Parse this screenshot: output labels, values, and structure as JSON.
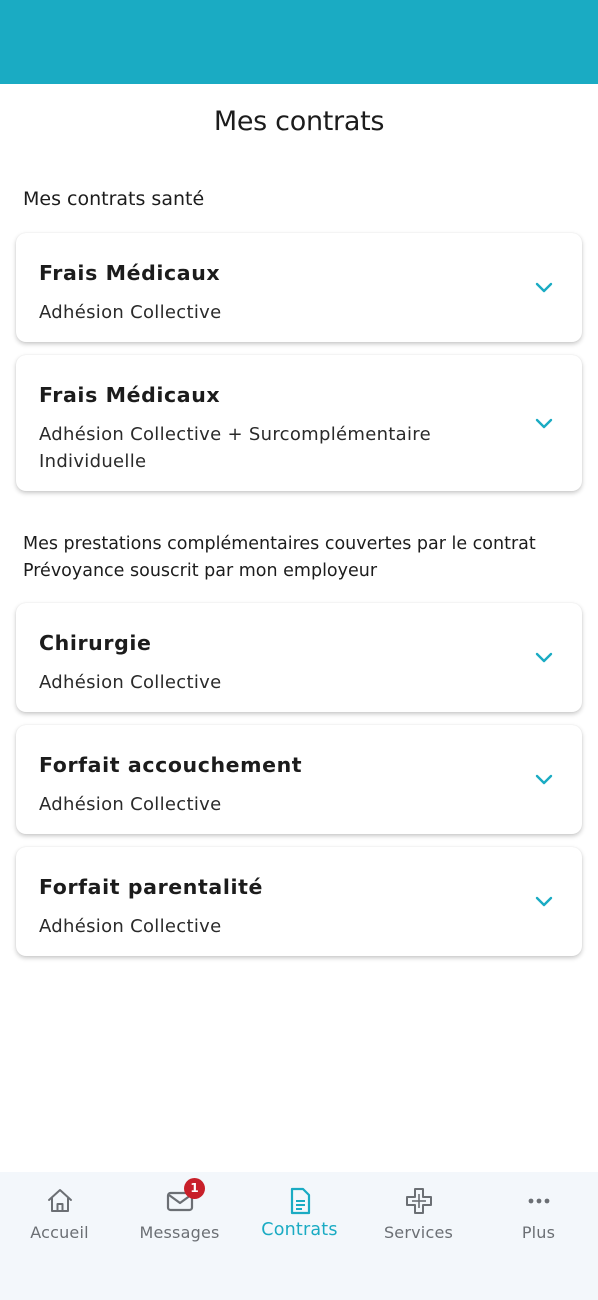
{
  "header": {
    "title": "Mes contrats"
  },
  "sections": [
    {
      "title": "Mes contrats santé",
      "cards": [
        {
          "title": "Frais Médicaux",
          "subtitle": "Adhésion Collective"
        },
        {
          "title": "Frais Médicaux",
          "subtitle": "Adhésion Collective + Surcomplémentaire Individuelle"
        }
      ]
    },
    {
      "title": "Mes prestations complémentaires couvertes par le contrat Prévoyance souscrit par mon employeur",
      "cards": [
        {
          "title": "Chirurgie",
          "subtitle": "Adhésion Collective"
        },
        {
          "title": "Forfait accouchement",
          "subtitle": "Adhésion Collective"
        },
        {
          "title": "Forfait parentalité",
          "subtitle": "Adhésion Collective"
        }
      ]
    }
  ],
  "nav": {
    "items": [
      {
        "label": "Accueil",
        "icon": "home-icon"
      },
      {
        "label": "Messages",
        "icon": "mail-icon",
        "badge": "1"
      },
      {
        "label": "Contrats",
        "icon": "document-icon",
        "active": true
      },
      {
        "label": "Services",
        "icon": "medical-cross-icon"
      },
      {
        "label": "Plus",
        "icon": "more-dots-icon"
      }
    ]
  },
  "colors": {
    "accent": "#1aabc3",
    "badge": "#c8202a",
    "nav_background": "#f3f7fb"
  }
}
